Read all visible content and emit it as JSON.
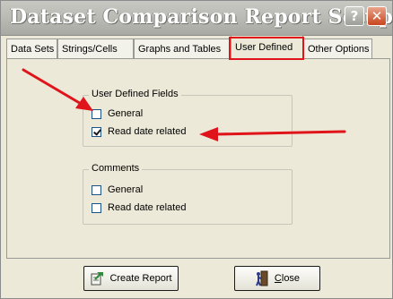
{
  "window": {
    "title": "Dataset Comparison Report Setup",
    "help_label": "?",
    "close_label": "✕"
  },
  "tabs": [
    {
      "label": "Data Sets",
      "active": false
    },
    {
      "label": "Strings/Cells",
      "active": false
    },
    {
      "label": "Graphs and Tables",
      "active": false
    },
    {
      "label": "User Defined",
      "active": true
    },
    {
      "label": "Other Options",
      "active": false
    }
  ],
  "user_defined_fields": {
    "label": "User Defined Fields",
    "items": [
      {
        "label": "General",
        "checked": false
      },
      {
        "label": "Read date related",
        "checked": true
      }
    ]
  },
  "comments": {
    "label": "Comments",
    "items": [
      {
        "label": "General",
        "checked": false
      },
      {
        "label": "Read date related",
        "checked": false
      }
    ]
  },
  "footer": {
    "create_label": "Create Report",
    "close_label_first": "C",
    "close_label_rest": "lose"
  },
  "colors": {
    "annotation_red": "#e0141b",
    "dialog_bg": "#ece9d8"
  },
  "icons": {
    "help": "question-mark-icon",
    "close": "close-icon",
    "create": "create-report-icon",
    "close_button": "door-exit-icon"
  }
}
